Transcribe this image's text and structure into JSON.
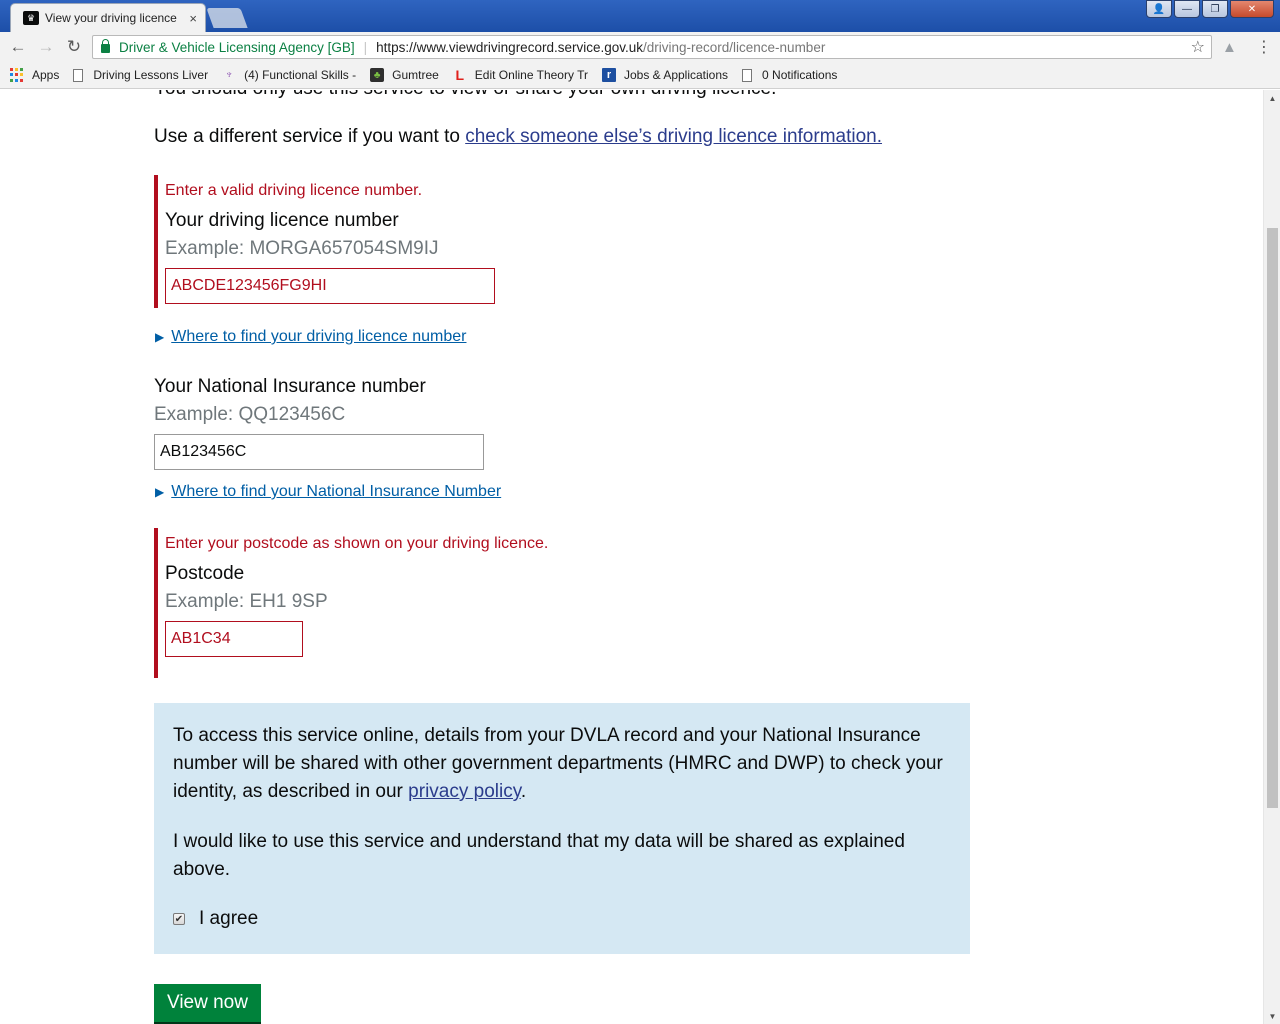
{
  "browser": {
    "tab_title": "View your driving licence",
    "tab_close": "×",
    "window_controls": {
      "profile": "👤",
      "minimize": "—",
      "maximize": "❐",
      "close": "✕"
    },
    "nav": {
      "back": "←",
      "forward": "→",
      "reload": "↻"
    },
    "site_identity": "Driver & Vehicle Licensing Agency [GB]",
    "url_host": "https://www.viewdrivingrecord.service.gov.uk",
    "url_path": "/driving-record/licence-number",
    "star": "☆",
    "menu": "⋮"
  },
  "bookmarks": [
    {
      "label": "Apps",
      "icon": "apps-grid-icon"
    },
    {
      "label": "Driving Lessons Liver",
      "icon": "page-icon"
    },
    {
      "label": "(4) Functional Skills -",
      "icon": "functional-skills-icon"
    },
    {
      "label": "Gumtree",
      "icon": "gumtree-icon"
    },
    {
      "label": "Edit Online Theory Tr",
      "icon": "l-plate-icon"
    },
    {
      "label": "Jobs & Applications",
      "icon": "reed-icon"
    },
    {
      "label": "0 Notifications",
      "icon": "page-icon"
    }
  ],
  "page": {
    "cut_off_text": "You should only use this service to view or share your own driving licence.",
    "intro_text": "Use a different service if you want to ",
    "intro_link": "check someone else’s driving licence information.",
    "licence": {
      "error": "Enter a valid driving licence number.",
      "label": "Your driving licence number",
      "hint": "Example: MORGA657054SM9IJ",
      "value": "ABCDE123456FG9HI",
      "details_link": "Where to find your driving licence number"
    },
    "ni": {
      "label": "Your National Insurance number",
      "hint": "Example: QQ123456C",
      "value": "AB123456C",
      "details_link": "Where to find your National Insurance Number"
    },
    "postcode": {
      "error": "Enter your postcode as shown on your driving licence.",
      "label": "Postcode",
      "hint": "Example: EH1 9SP",
      "value": "AB1C34"
    },
    "consent": {
      "text_1": "To access this service online, details from your DVLA record and your National Insurance number will be shared with other government departments (HMRC and DWP) to check your identity, as described in our ",
      "privacy_link": "privacy policy",
      "text_1_end": ".",
      "text_2": "I would like to use this service and understand that my data will be shared as explained above.",
      "checkbox_mark": "✔",
      "agree_label": "I agree",
      "agree_checked": true
    },
    "submit_label": "View now"
  },
  "colors": {
    "error": "#b10e1e",
    "link": "#2b3c8c",
    "details_link": "#005ea5",
    "panel": "#d5e8f3",
    "button": "#00823b"
  }
}
